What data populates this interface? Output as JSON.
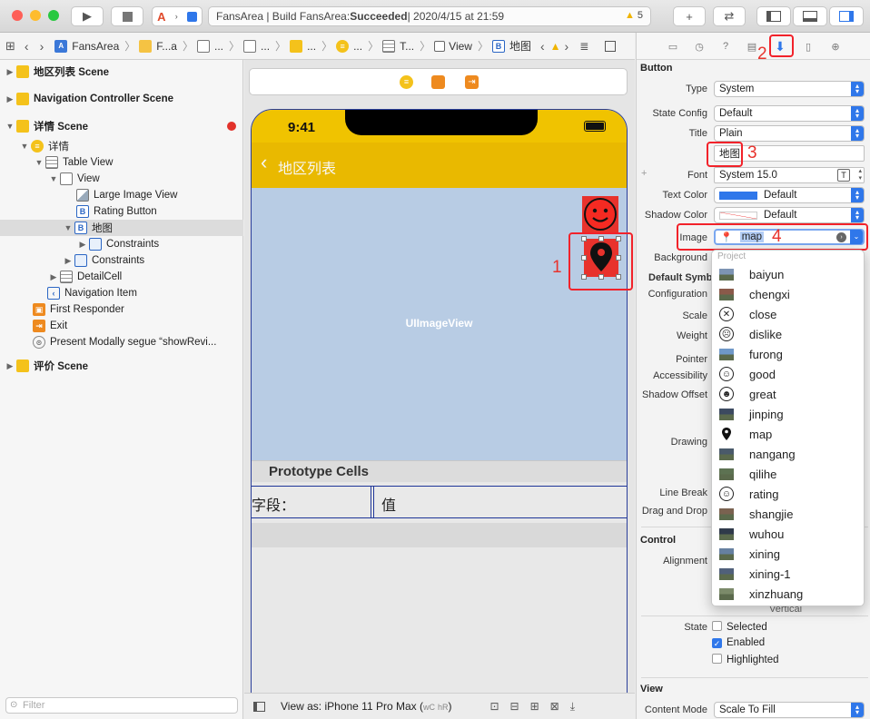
{
  "toolbar": {
    "status_prefix": "FansArea | Build FansArea: ",
    "status_bold": "Succeeded",
    "status_suffix": " | 2020/4/15 at 21:59",
    "warning_count": "5",
    "add_label": "+",
    "swap_label": "⇄"
  },
  "jumpbar": {
    "items": [
      "FansArea",
      "F...a",
      "...",
      "...",
      "...",
      "...",
      "T...",
      "View",
      "B",
      "地图"
    ]
  },
  "navigator": {
    "rows": [
      {
        "label": "地区列表 Scene",
        "bold": true
      },
      {
        "label": "Navigation Controller Scene",
        "bold": true
      },
      {
        "label": "详情 Scene",
        "bold": true
      },
      {
        "label": "详情"
      },
      {
        "label": "Table View"
      },
      {
        "label": "View"
      },
      {
        "label": "Large Image View"
      },
      {
        "label": "Rating Button"
      },
      {
        "label": "地图"
      },
      {
        "label": "Constraints"
      },
      {
        "label": "Constraints"
      },
      {
        "label": "DetailCell"
      },
      {
        "label": "Navigation Item"
      },
      {
        "label": "First Responder"
      },
      {
        "label": "Exit"
      },
      {
        "label": "Present Modally segue “showRevi..."
      },
      {
        "label": "评价 Scene",
        "bold": true
      }
    ],
    "filter_placeholder": "Filter"
  },
  "canvas": {
    "time": "9:41",
    "back_label": "地区列表",
    "image_view_label": "UIImageView",
    "prototype_label": "Prototype Cells",
    "cell_field": "字段：",
    "cell_value": "值",
    "view_as": "View as: iPhone 11 Pro Max (",
    "view_as_w": "wC",
    "view_as_h": "hR",
    "view_as_end": ")"
  },
  "annotations": {
    "a1": "1",
    "a2": "2",
    "a3": "3",
    "a4": "4"
  },
  "inspector": {
    "section_button": "Button",
    "type_label": "Type",
    "type_value": "System",
    "state_config_label": "State Config",
    "state_config_value": "Default",
    "title_label": "Title",
    "title_value": "Plain",
    "title_text": "地图",
    "font_label": "Font",
    "font_value": "System 15.0",
    "text_color_label": "Text Color",
    "text_color_value": "Default",
    "shadow_color_label": "Shadow Color",
    "shadow_color_value": "Default",
    "image_label": "Image",
    "image_value": "map",
    "background_label": "Background",
    "default_symbol_label": "Default Symbo",
    "configuration_label": "Configuration",
    "scale_label": "Scale",
    "weight_label": "Weight",
    "pointer_label": "Pointer",
    "accessibility_label": "Accessibility",
    "shadow_offset_label": "Shadow Offset",
    "drawing_label": "Drawing",
    "line_break_label": "Line Break",
    "drag_drop_label": "Drag and Drop",
    "section_control": "Control",
    "alignment_label": "Alignment",
    "vertical_label": "Vertical",
    "state_label": "State",
    "selected_label": "Selected",
    "enabled_label": "Enabled",
    "highlighted_label": "Highlighted",
    "section_view": "View",
    "content_mode_label": "Content Mode",
    "content_mode_value": "Scale To Fill"
  },
  "image_dropdown": {
    "header": "Project",
    "items": [
      {
        "name": "baiyun",
        "kind": "photo"
      },
      {
        "name": "chengxi",
        "kind": "photo"
      },
      {
        "name": "close",
        "kind": "symbol",
        "glyph": "✕"
      },
      {
        "name": "dislike",
        "kind": "symbol",
        "glyph": "☹"
      },
      {
        "name": "furong",
        "kind": "photo"
      },
      {
        "name": "good",
        "kind": "symbol",
        "glyph": "☺"
      },
      {
        "name": "great",
        "kind": "symbol",
        "glyph": "☻"
      },
      {
        "name": "jinping",
        "kind": "photo"
      },
      {
        "name": "map",
        "kind": "pin"
      },
      {
        "name": "nangang",
        "kind": "photo"
      },
      {
        "name": "qilihe",
        "kind": "photo"
      },
      {
        "name": "rating",
        "kind": "symbol",
        "glyph": "☺"
      },
      {
        "name": "shangjie",
        "kind": "photo"
      },
      {
        "name": "wuhou",
        "kind": "photo"
      },
      {
        "name": "xining",
        "kind": "photo"
      },
      {
        "name": "xining-1",
        "kind": "photo"
      },
      {
        "name": "xinzhuang",
        "kind": "photo"
      }
    ]
  },
  "colors": {
    "accent": "#2f77ea",
    "annotation_red": "#f2222a",
    "nav_yellow": "#e9b900"
  }
}
